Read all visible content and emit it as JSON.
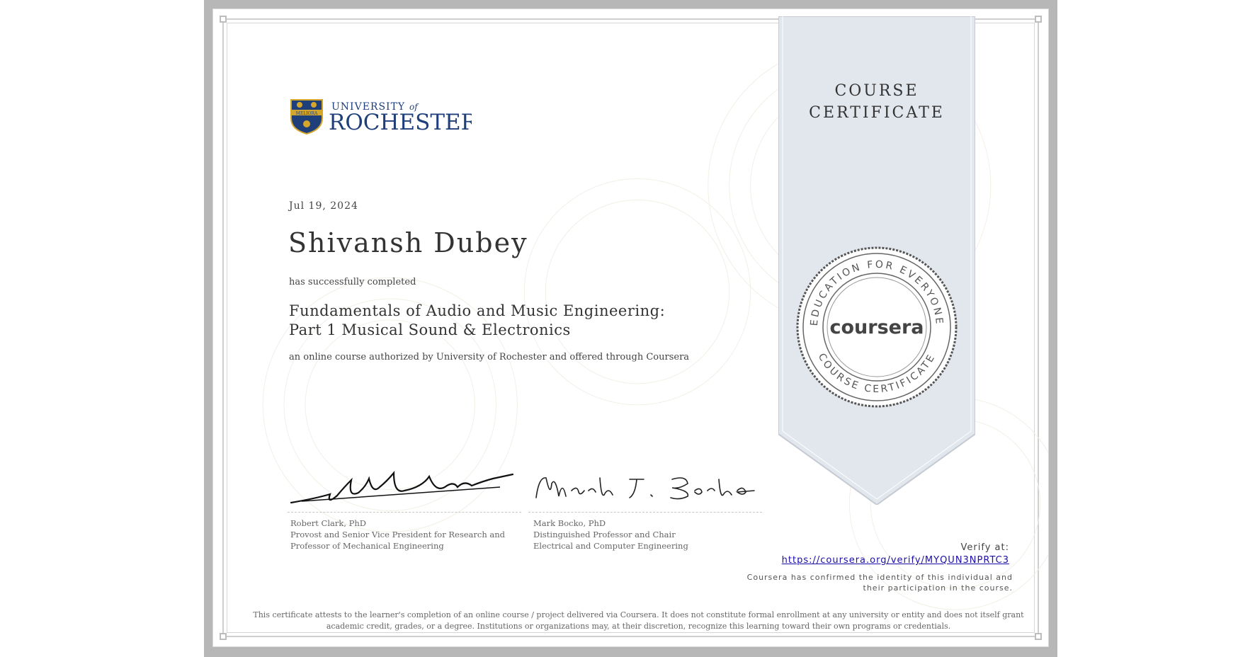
{
  "ribbon": {
    "title_line1": "COURSE",
    "title_line2": "CERTIFICATE"
  },
  "issuer": {
    "logo_top": "UNIVERSITY",
    "logo_of": "of",
    "logo_name": "ROCHESTER",
    "logo_motto": "MELIORA"
  },
  "certificate": {
    "date": "Jul 19, 2024",
    "recipient": "Shivansh Dubey",
    "completed_text": "has successfully completed",
    "course_line1": "Fundamentals of Audio and Music Engineering:",
    "course_line2": "Part 1 Musical Sound & Electronics",
    "authorized_text": "an online course authorized by University of Rochester and offered through Coursera"
  },
  "signers": [
    {
      "name": "Robert Clark, PhD",
      "title_line1": "Provost and Senior Vice President for Research and",
      "title_line2": "Professor of Mechanical Engineering"
    },
    {
      "name": "Mark Bocko, PhD",
      "title_line1": "Distinguished Professor and Chair",
      "title_line2": "Electrical and Computer Engineering"
    }
  ],
  "seal": {
    "brand": "coursera",
    "ring_top": "EDUCATION FOR EVERYONE",
    "ring_bottom": "COURSE CERTIFICATE"
  },
  "verify": {
    "label": "Verify at:",
    "url": "https://coursera.org/verify/MYQUN3NPRTC3",
    "confirmed_text": "Coursera has confirmed the identity of this individual and their participation in the course."
  },
  "disclaimer": "This certificate attests to the learner's completion of an online course / project delivered via Coursera. It does not constitute formal enrollment at any university or entity and does not itself grant academic credit, grades, or a degree. Institutions or organizations may, at their discretion, recognize this learning toward their own programs or credentials.",
  "colors": {
    "ribbon_fill": "#e2e6ed",
    "ribbon_stroke": "#c5cad3",
    "border_gray": "#b7b7b7",
    "link_blue": "#1a0dab",
    "rochester_blue": "#1f3f7a",
    "rochester_gold": "#d4a72c"
  }
}
